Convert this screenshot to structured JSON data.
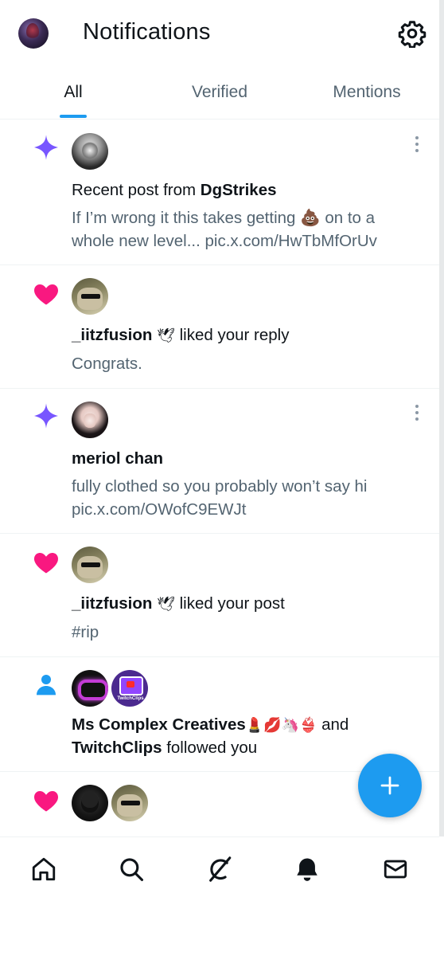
{
  "header": {
    "title": "Notifications",
    "avatar_icon": "user-avatar",
    "settings_icon": "gear-icon"
  },
  "tabs": [
    {
      "label": "All",
      "active": true
    },
    {
      "label": "Verified",
      "active": false
    },
    {
      "label": "Mentions",
      "active": false
    }
  ],
  "notifications": [
    {
      "kind": "recent-post",
      "icon": "sparkle-icon",
      "line1_prefix": "Recent post from ",
      "line1_name": "DgStrikes",
      "text_line1": "If I’m wrong it this takes getting 💩 on to a",
      "text_line2": "whole new level... pic.x.com/HwTbMfOrUv"
    },
    {
      "kind": "like",
      "icon": "heart-icon",
      "name": "_iitzfusion",
      "badge_emoji": "🕊",
      "action": " liked your reply",
      "text_line1": "Congrats."
    },
    {
      "kind": "recent-post",
      "icon": "sparkle-icon",
      "name": "meriol chan",
      "text_line1": "fully clothed so you probably won’t say hi",
      "text_line2": "pic.x.com/OWofC9EWJt"
    },
    {
      "kind": "like",
      "icon": "heart-icon",
      "name": "_iitzfusion",
      "badge_emoji": "🕊",
      "action": " liked your post",
      "text_line1": "#rip"
    },
    {
      "kind": "follow",
      "icon": "person-icon",
      "name1": "Ms Complex Creatives",
      "name1_emojis": "💄💋🦄👙",
      "joiner": " and",
      "name2": "TwitchClips",
      "action": " followed you",
      "twitch_avatar_text": "TwitchClips"
    },
    {
      "kind": "like",
      "icon": "heart-icon"
    }
  ],
  "fab": {
    "icon": "plus-icon"
  },
  "bottom_nav": [
    {
      "icon": "home-icon"
    },
    {
      "icon": "search-icon"
    },
    {
      "icon": "grok-icon"
    },
    {
      "icon": "bell-icon",
      "active": true
    },
    {
      "icon": "mail-icon"
    }
  ],
  "colors": {
    "accent": "#1d9bf0",
    "heart": "#f91880",
    "sparkle": "#7856ff",
    "text": "#0f1419",
    "muted": "#536471"
  }
}
